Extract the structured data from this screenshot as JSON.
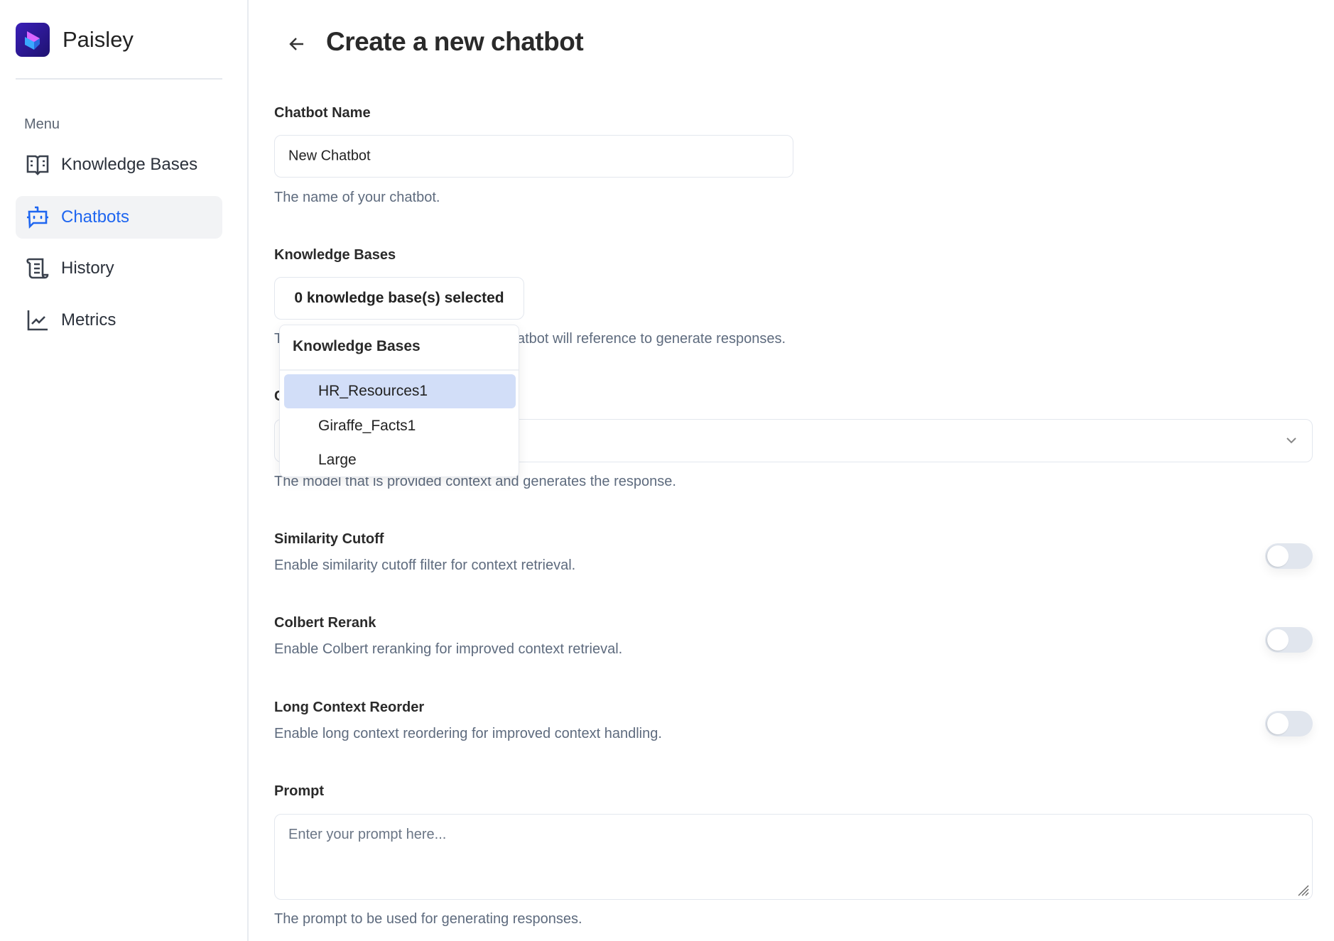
{
  "app": {
    "name": "Paisley"
  },
  "sidebar": {
    "menu_label": "Menu",
    "items": [
      {
        "label": "Knowledge Bases",
        "icon": "book-open-icon",
        "active": false
      },
      {
        "label": "Chatbots",
        "icon": "bot-icon",
        "active": true
      },
      {
        "label": "History",
        "icon": "scroll-icon",
        "active": false
      },
      {
        "label": "Metrics",
        "icon": "line-chart-icon",
        "active": false
      }
    ]
  },
  "header": {
    "title": "Create a new chatbot",
    "back_icon": "arrow-left-icon"
  },
  "form": {
    "name": {
      "label": "Chatbot Name",
      "value": "New Chatbot",
      "help": "The name of your chatbot."
    },
    "knowledge_bases": {
      "label": "Knowledge Bases",
      "button": "0 knowledge base(s) selected",
      "help_start": "T",
      "help_end": "atbot will reference to generate responses.",
      "dropdown": {
        "header": "Knowledge Bases",
        "options": [
          "HR_Resources1",
          "Giraffe_Facts1",
          "Large"
        ],
        "highlighted": "HR_Resources1"
      }
    },
    "model": {
      "label_start": "C",
      "help": "The model that is provided context and generates the response."
    },
    "similarity": {
      "label": "Similarity Cutoff",
      "help": "Enable similarity cutoff filter for context retrieval.",
      "enabled": false
    },
    "colbert": {
      "label": "Colbert Rerank",
      "help": "Enable Colbert reranking for improved context retrieval.",
      "enabled": false
    },
    "long_context": {
      "label": "Long Context Reorder",
      "help": "Enable long context reordering for improved context handling.",
      "enabled": false
    },
    "prompt": {
      "label": "Prompt",
      "placeholder": "Enter your prompt here...",
      "help": "The prompt to be used for generating responses."
    }
  },
  "colors": {
    "accent": "#1f66f0",
    "highlight": "#d2def8",
    "brand": "#3b1fb8"
  }
}
